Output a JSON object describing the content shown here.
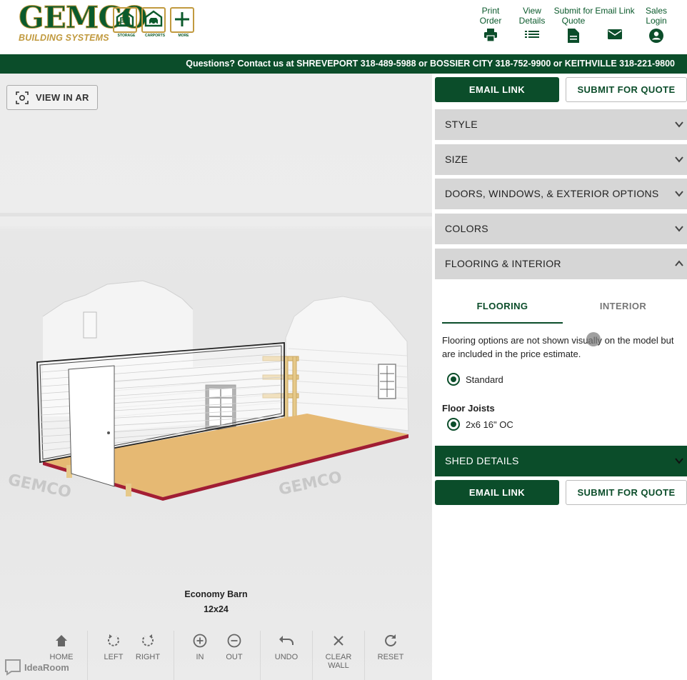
{
  "brand": {
    "logo_text": "GEMCO",
    "logo_sub": "BUILDING SYSTEMS",
    "categories": [
      {
        "label": "STORAGE",
        "icon": "storage-building-icon"
      },
      {
        "label": "CARPORTS",
        "icon": "carport-icon"
      },
      {
        "label": "MORE",
        "icon": "plus-icon"
      }
    ],
    "colors": {
      "green": "#0b4d2a",
      "gold": "#c19a3f"
    }
  },
  "topnav": [
    {
      "label": "Print Order",
      "icon": "printer-icon"
    },
    {
      "label": "View Details",
      "icon": "list-icon"
    },
    {
      "label": "Submit for Quote",
      "icon": "document-icon"
    },
    {
      "label": "Email Link",
      "icon": "mail-icon"
    },
    {
      "label": "Sales Login",
      "icon": "account-icon"
    }
  ],
  "contact_bar": "Questions? Contact us at SHREVEPORT 318-489-5988 or BOSSIER CITY 318-752-9900 or KEITHVILLE 318-221-9800",
  "viewer": {
    "ar_button": "VIEW IN AR",
    "model_name": "Economy Barn",
    "model_size": "12x24",
    "watermark": "IdeaRoom",
    "toolbar": [
      [
        {
          "label": "HOME",
          "icon": "home-icon"
        }
      ],
      [
        {
          "label": "LEFT",
          "icon": "rotate-left-icon"
        },
        {
          "label": "RIGHT",
          "icon": "rotate-right-icon"
        }
      ],
      [
        {
          "label": "IN",
          "icon": "zoom-in-icon"
        },
        {
          "label": "OUT",
          "icon": "zoom-out-icon"
        }
      ],
      [
        {
          "label": "UNDO",
          "icon": "undo-icon"
        }
      ],
      [
        {
          "label": "CLEAR WALL",
          "icon": "close-icon"
        }
      ],
      [
        {
          "label": "RESET",
          "icon": "reset-icon"
        }
      ]
    ]
  },
  "panel": {
    "email_link": "EMAIL LINK",
    "submit_quote": "SUBMIT FOR QUOTE",
    "sections": [
      "STYLE",
      "SIZE",
      "DOORS, WINDOWS, & EXTERIOR OPTIONS",
      "COLORS",
      "FLOORING & INTERIOR"
    ],
    "tabs": {
      "active": "FLOORING",
      "inactive": "INTERIOR"
    },
    "flooring_note": "Flooring options are not shown visually on the model but are included in the price estimate.",
    "flooring_option": "Standard",
    "floor_joists_label": "Floor Joists",
    "floor_joists_option": "2x6 16\" OC",
    "shed_details": "SHED DETAILS"
  }
}
